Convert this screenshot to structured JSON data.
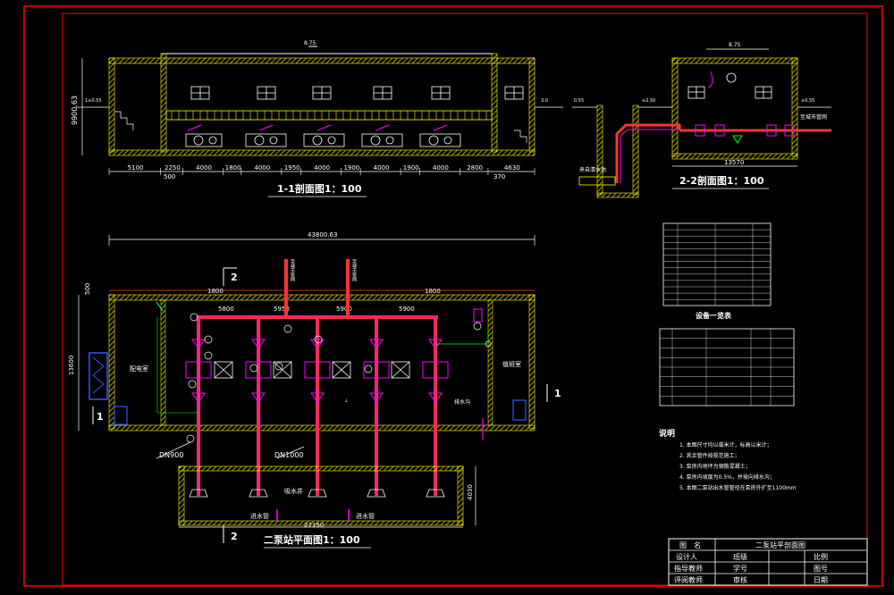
{
  "section_1_1": {
    "title": "1-1剖面图1：100",
    "height_dim": "9900.63",
    "top_mark": "8.75",
    "left_level": "1≥0.55",
    "right_level": "3.0",
    "dims": [
      "5100",
      "2250",
      "4000",
      "1800",
      "4000",
      "1950",
      "4000",
      "1900",
      "4000",
      "1900",
      "4000",
      "2800",
      "4630"
    ],
    "bottom_left": "500",
    "bottom_right": "370"
  },
  "section_2_2": {
    "title": "2-2剖面图1：100",
    "top_mark": "8.75",
    "width_dim": "13570",
    "label_left": "来自清水池",
    "label_right": "至城市管网",
    "level_left": "0.55",
    "level_mid": "≥2.50",
    "level_right": "≥0.55"
  },
  "plan": {
    "title": "二泵站平面图1：100",
    "total_width": "43800.63",
    "dim_top_left": "1800",
    "dim_top_right": "1800",
    "dims_row": [
      "5800",
      "5950",
      "5900",
      "5900"
    ],
    "left_height": "13600",
    "left_top": "500",
    "bottom_width": "27150",
    "bottom_height": "4030",
    "room_left": "配电室",
    "room_right": "值班室",
    "label_drain": "排水沟",
    "label_suction": "吸水井",
    "label_in_pipe": "进水管",
    "label_in_pipe2": "进水管",
    "pipe_dn900": "DN900",
    "pipe_dn1000": "DN1000",
    "section_marks": [
      "1",
      "1",
      "2",
      "2"
    ],
    "riser_labels": [
      "至城市管网",
      "至城市管网"
    ]
  },
  "equipment": {
    "title": "设备一览表"
  },
  "notes": {
    "title": "说明",
    "lines": [
      "1. 本图尺寸均以毫米计，标高以米计；",
      "2. 其余管件按规范施工；",
      "3. 泵房内地坪为钢筋混凝土；",
      "4. 泵房内坡度为0.5%，并坡向排水沟；",
      "5. 本图二泵站出水管管径在泵房外扩至1100mm"
    ]
  },
  "title_block": {
    "r1c1": "图　名",
    "r1c2": "二泵站平剖面图",
    "r2c1": "设计人",
    "r2c2": "班级",
    "r2c3": "比例",
    "r3c1": "指导教师",
    "r3c2": "学号",
    "r3c3": "图号",
    "r4c1": "评阅教师",
    "r4c2": "审核",
    "r4c3": "日期"
  },
  "colors": {
    "frame": "#ff0000",
    "wall": "#ffff00",
    "pipe_red": "#ff3333",
    "pipe_magenta": "#ff00ff",
    "line_white": "#ffffff",
    "green": "#00ff00",
    "blue": "#3355ff",
    "cyan": "#00ffff"
  }
}
